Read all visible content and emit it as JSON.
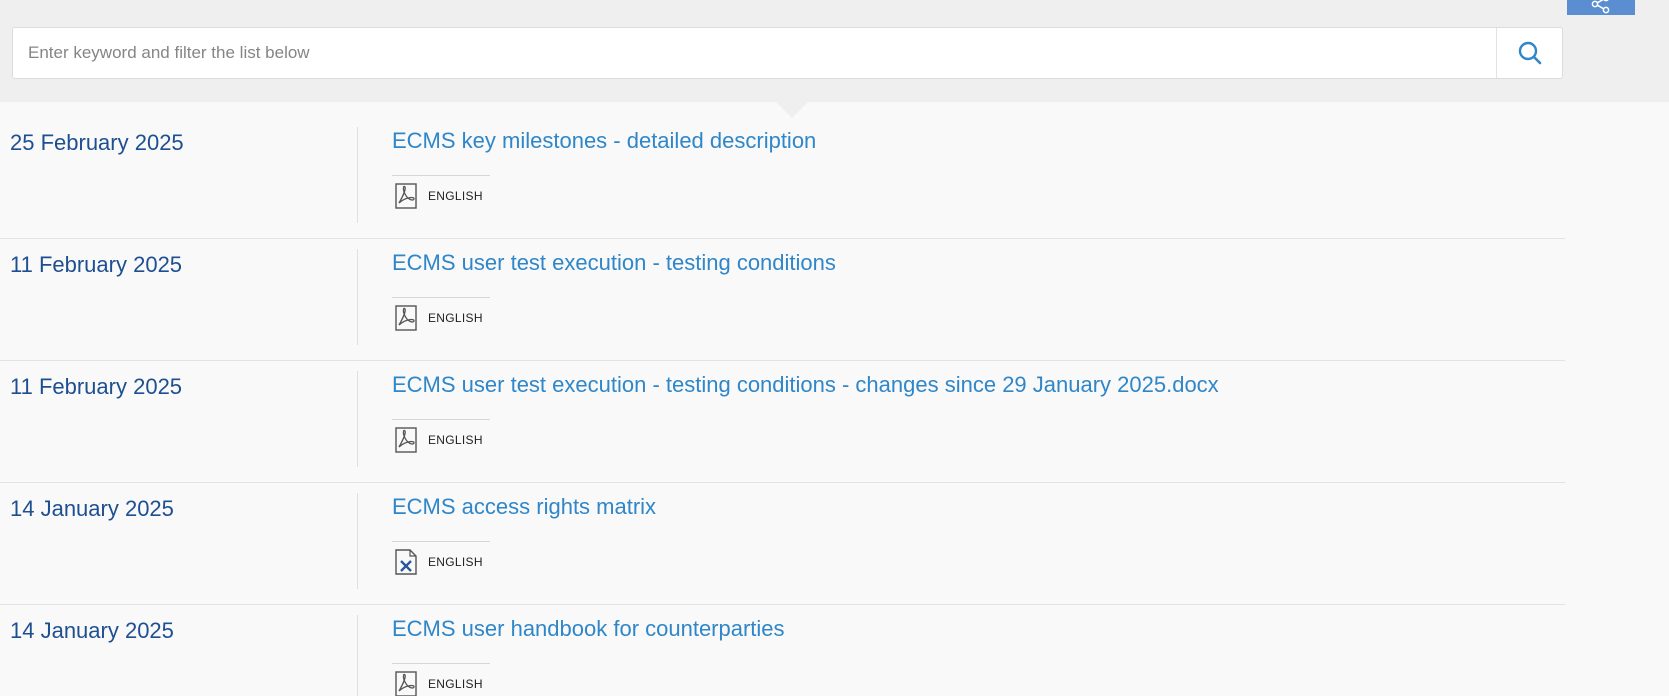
{
  "search": {
    "placeholder": "Enter keyword and filter the list below",
    "icon": "search-icon"
  },
  "share": {
    "icon": "share-icon",
    "color": "#5b8ed1"
  },
  "colors": {
    "date": "#1d4f91",
    "link": "#2f86c8",
    "band": "#efefef"
  },
  "items": [
    {
      "date": "25 February 2025",
      "title": "ECMS key milestones - detailed description",
      "file_type": "pdf",
      "file_label": "ENGLISH"
    },
    {
      "date": "11 February 2025",
      "title": "ECMS user test execution - testing conditions",
      "file_type": "pdf",
      "file_label": "ENGLISH"
    },
    {
      "date": "11 February 2025",
      "title": "ECMS user test execution - testing conditions - changes since 29 January 2025.docx",
      "file_type": "pdf",
      "file_label": "ENGLISH"
    },
    {
      "date": "14 January 2025",
      "title": "ECMS access rights matrix",
      "file_type": "excel",
      "file_label": "ENGLISH"
    },
    {
      "date": "14 January 2025",
      "title": "ECMS user handbook for counterparties",
      "file_type": "pdf",
      "file_label": "ENGLISH"
    }
  ]
}
